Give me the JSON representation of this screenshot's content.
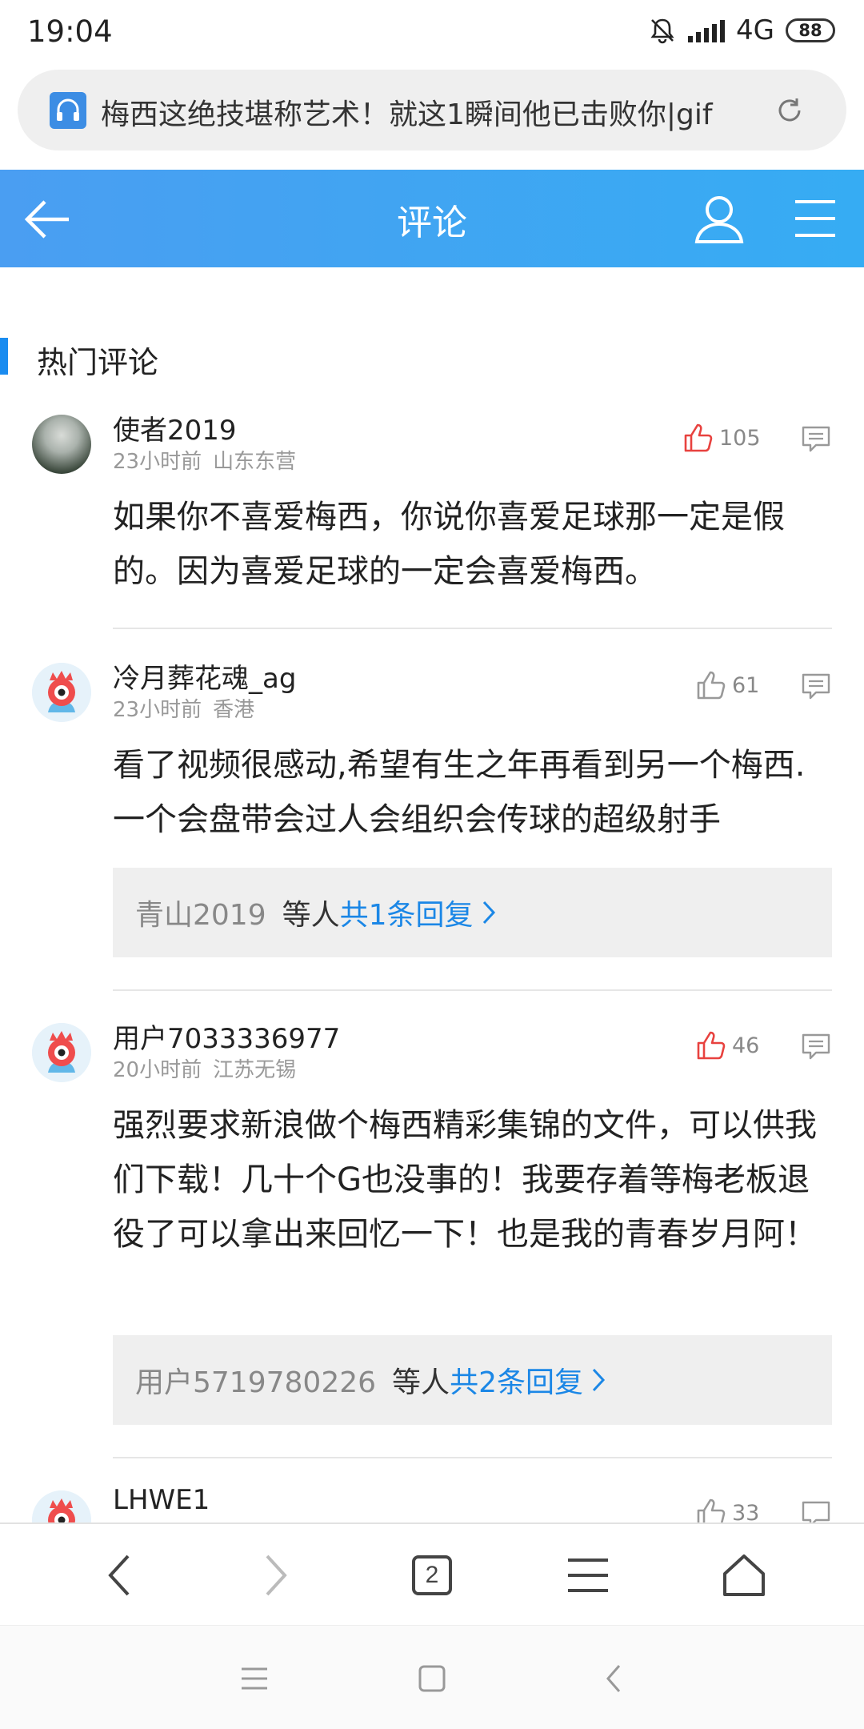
{
  "status": {
    "time": "19:04",
    "network": "4G",
    "battery": "88"
  },
  "url_bar": {
    "title": "梅西这绝技堪称艺术！就这1瞬间他已击败你|gif"
  },
  "title_bar": {
    "title": "评论"
  },
  "section": {
    "title": "热门评论"
  },
  "comments": [
    {
      "username": "使者2019",
      "time": "23小时前",
      "location": "山东东营",
      "likes": "105",
      "liked": true,
      "text": "如果你不喜爱梅西，你说你喜爱足球那一定是假的。因为喜爱足球的一定会喜爱梅西。"
    },
    {
      "username": "冷月葬花魂_ag",
      "time": "23小时前",
      "location": "香港",
      "likes": "61",
      "liked": false,
      "text": "看了视频很感动,希望有生之年再看到另一个梅西.一个会盘带会过人会组织会传球的超级射手",
      "reply": {
        "user": "青山2019",
        "mid": "等人",
        "link": "共1条回复"
      }
    },
    {
      "username": "用户7033336977",
      "time": "20小时前",
      "location": "江苏无锡",
      "likes": "46",
      "liked": true,
      "text": "强烈要求新浪做个梅西精彩集锦的文件，可以供我们下载！几十个G也没事的！我要存着等梅老板退役了可以拿出来回忆一下！也是我的青春岁月阿！",
      "reply": {
        "user": "用户5719780226",
        "mid": "等人",
        "link": "共2条回复"
      }
    },
    {
      "username": "LHWE1",
      "likes": "33",
      "liked": false
    }
  ],
  "browser_nav": {
    "tab_count": "2"
  },
  "colors": {
    "accent": "#1b87e6",
    "title_bar": "#4a9ef2",
    "liked": "#e8423f"
  },
  "icons": [
    "bell-off-icon",
    "signal-icon",
    "battery-icon",
    "headphone-icon",
    "refresh-icon",
    "back-arrow-icon",
    "user-icon",
    "menu-icon",
    "thumbs-up-icon",
    "reply-icon",
    "chevron-right-icon",
    "nav-back-icon",
    "nav-forward-icon",
    "tabs-icon",
    "nav-menu-icon",
    "home-icon"
  ]
}
